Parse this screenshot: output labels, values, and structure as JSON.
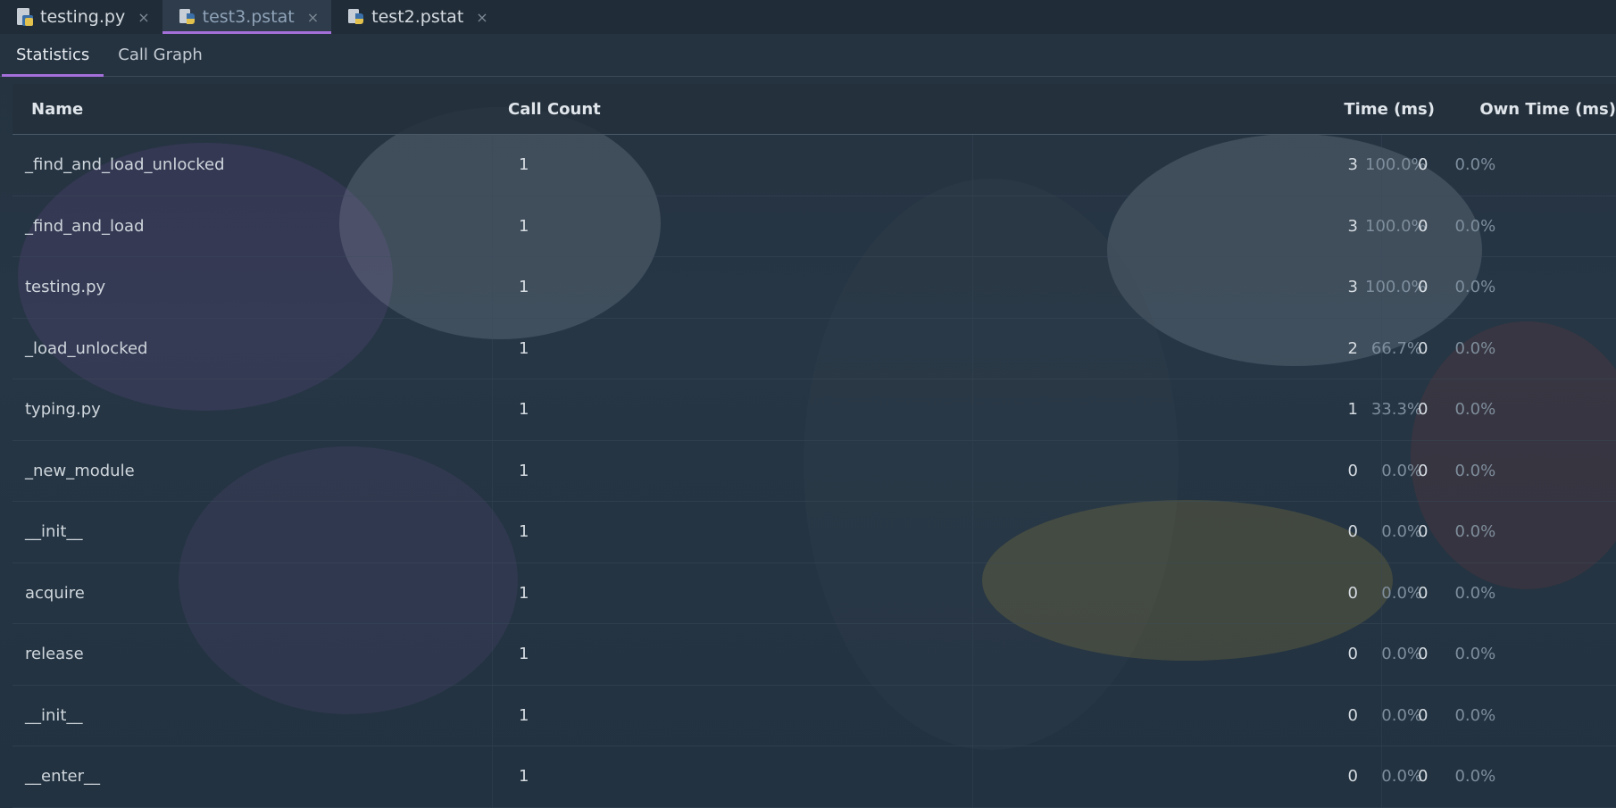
{
  "editor_tabs": [
    {
      "label": "testing.py",
      "icon": "python-file-icon",
      "active": false
    },
    {
      "label": "test3.pstat",
      "icon": "pstat-file-icon",
      "active": true
    },
    {
      "label": "test2.pstat",
      "icon": "pstat-file-icon",
      "active": false
    }
  ],
  "close_glyph": "×",
  "sub_tabs": [
    {
      "label": "Statistics",
      "active": true
    },
    {
      "label": "Call Graph",
      "active": false
    }
  ],
  "table": {
    "headers": {
      "name": "Name",
      "call_count": "Call Count",
      "time": "Time (ms)",
      "own_time": "Own Time (ms)"
    },
    "rows": [
      {
        "name": "_find_and_load_unlocked",
        "call_count": "1",
        "time": "3",
        "time_pct": "100.0%",
        "own_time": "0",
        "own_pct": "0.0%"
      },
      {
        "name": "_find_and_load",
        "call_count": "1",
        "time": "3",
        "time_pct": "100.0%",
        "own_time": "0",
        "own_pct": "0.0%"
      },
      {
        "name": "testing.py",
        "call_count": "1",
        "time": "3",
        "time_pct": "100.0%",
        "own_time": "0",
        "own_pct": "0.0%"
      },
      {
        "name": "_load_unlocked",
        "call_count": "1",
        "time": "2",
        "time_pct": "66.7%",
        "own_time": "0",
        "own_pct": "0.0%"
      },
      {
        "name": "typing.py",
        "call_count": "1",
        "time": "1",
        "time_pct": "33.3%",
        "own_time": "0",
        "own_pct": "0.0%"
      },
      {
        "name": "_new_module",
        "call_count": "1",
        "time": "0",
        "time_pct": "0.0%",
        "own_time": "0",
        "own_pct": "0.0%"
      },
      {
        "name": "__init__",
        "call_count": "1",
        "time": "0",
        "time_pct": "0.0%",
        "own_time": "0",
        "own_pct": "0.0%"
      },
      {
        "name": "acquire",
        "call_count": "1",
        "time": "0",
        "time_pct": "0.0%",
        "own_time": "0",
        "own_pct": "0.0%"
      },
      {
        "name": "release",
        "call_count": "1",
        "time": "0",
        "time_pct": "0.0%",
        "own_time": "0",
        "own_pct": "0.0%"
      },
      {
        "name": "__init__",
        "call_count": "1",
        "time": "0",
        "time_pct": "0.0%",
        "own_time": "0",
        "own_pct": "0.0%"
      },
      {
        "name": "__enter__",
        "call_count": "1",
        "time": "0",
        "time_pct": "0.0%",
        "own_time": "0",
        "own_pct": "0.0%"
      }
    ]
  },
  "colors": {
    "accent": "#a46fd9",
    "background": "#243341",
    "muted_text": "#7f8e9c"
  }
}
